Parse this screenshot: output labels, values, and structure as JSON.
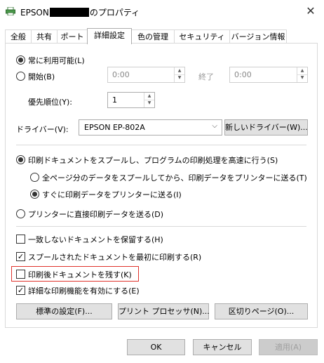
{
  "window": {
    "title_prefix": "EPSON",
    "title_suffix": "のプロパティ",
    "app_icon": "printer-icon",
    "close_icon": "close-icon"
  },
  "tabs": [
    {
      "label": "全般",
      "active": false
    },
    {
      "label": "共有",
      "active": false
    },
    {
      "label": "ポート",
      "active": false
    },
    {
      "label": "詳細設定",
      "active": true
    },
    {
      "label": "色の管理",
      "active": false
    },
    {
      "label": "セキュリティ",
      "active": false
    },
    {
      "label": "バージョン情報",
      "active": false
    }
  ],
  "availability": {
    "always_label": "常に利用可能(L)",
    "always_selected": true,
    "from_label": "開始(B)",
    "from_selected": false,
    "start_time": "0:00",
    "until_label": "終了",
    "end_time": "0:00"
  },
  "priority": {
    "label": "優先順位(Y):",
    "value": "1"
  },
  "driver": {
    "label": "ドライバー(V):",
    "selected": "EPSON EP-802A",
    "new_driver_button": "新しいドライバー(W)..."
  },
  "spool": {
    "spool_label": "印刷ドキュメントをスプールし、プログラムの印刷処理を高速に行う(S)",
    "spool_selected": true,
    "after_last_page_label": "全ページ分のデータをスプールしてから、印刷データをプリンターに送る(T)",
    "after_last_page_selected": false,
    "immediately_label": "すぐに印刷データをプリンターに送る(I)",
    "immediately_selected": true,
    "direct_label": "プリンターに直接印刷データを送る(D)",
    "direct_selected": false
  },
  "options": [
    {
      "label": "一致しないドキュメントを保留する(H)",
      "checked": false
    },
    {
      "label": "スプールされたドキュメントを最初に印刷する(R)",
      "checked": true
    },
    {
      "label": "印刷後ドキュメントを残す(K)",
      "checked": false
    },
    {
      "label": "詳細な印刷機能を有効にする(E)",
      "checked": true
    }
  ],
  "bottom_buttons": {
    "defaults": "標準の設定(F)...",
    "print_processor": "プリント プロセッサ(N)...",
    "separator_page": "区切りページ(O)..."
  },
  "dialog_buttons": {
    "ok": "OK",
    "cancel": "キャンセル",
    "apply": "適用(A)"
  },
  "colors": {
    "highlight_box": "#e0332c",
    "button_bg": "#e1e1e1"
  }
}
